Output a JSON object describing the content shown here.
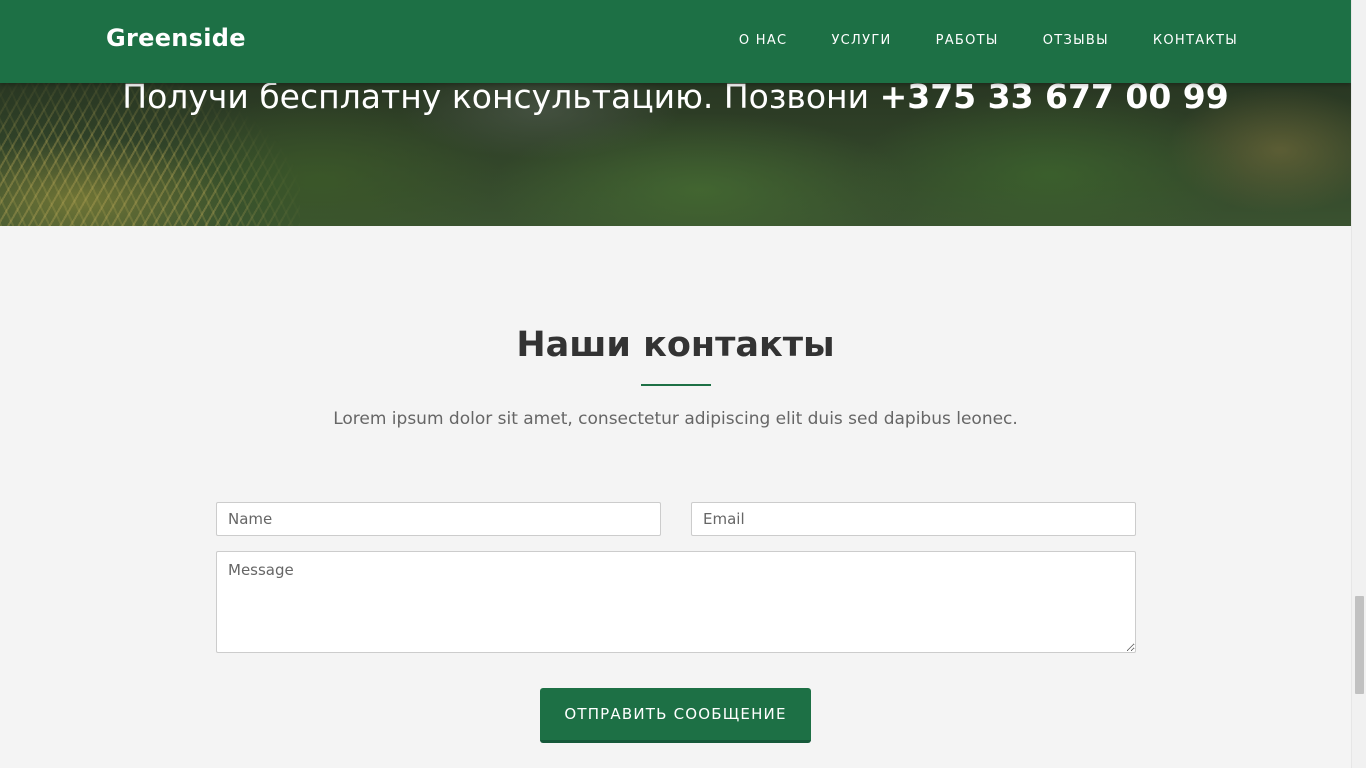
{
  "navbar": {
    "brand": "Greenside",
    "links": [
      "О НАС",
      "УСЛУГИ",
      "РАБОТЫ",
      "ОТЗЫВЫ",
      "КОНТАКТЫ"
    ],
    "background": "#1d7045"
  },
  "hero": {
    "text": "Получи бесплатну консультацию. Позвони",
    "phone": "+375 33 677 00 99"
  },
  "contacts": {
    "title": "Наши контакты",
    "subtitle": "Lorem ipsum dolor sit amet, consectetur adipiscing elit duis sed dapibus leonec.",
    "form": {
      "name_placeholder": "Name",
      "email_placeholder": "Email",
      "message_placeholder": "Message",
      "submit_label": "ОТПРАВИТЬ СООБЩЕНИЕ"
    }
  },
  "colors": {
    "accent": "#1d7045",
    "page_background": "#f4f4f4",
    "title_text": "#333333"
  }
}
